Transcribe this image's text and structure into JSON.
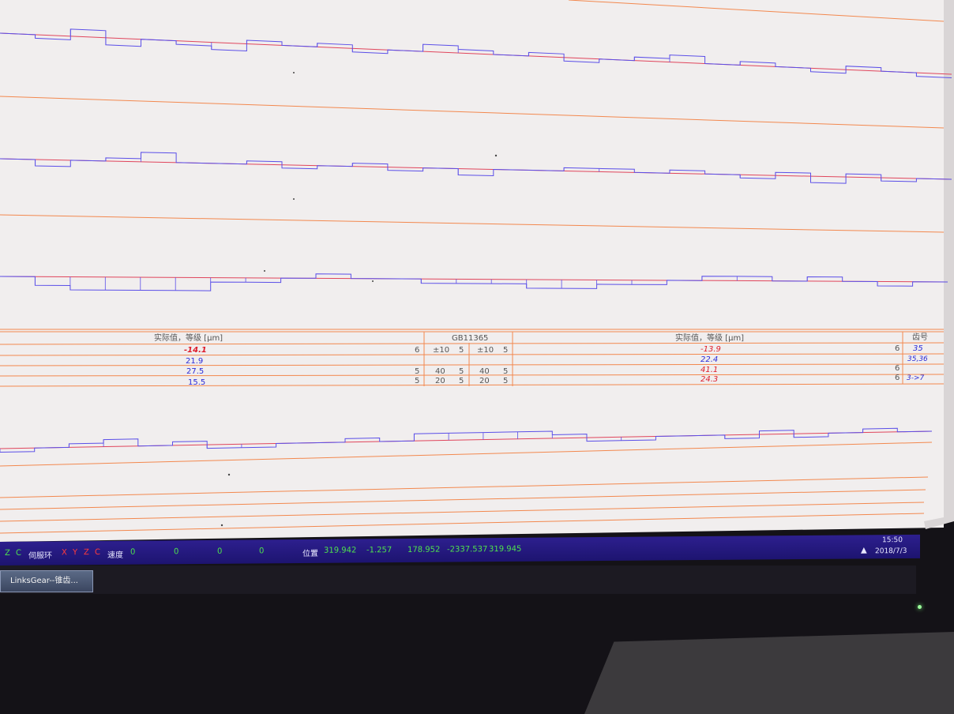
{
  "table": {
    "left_header": "实际值，等级 [µm]",
    "standard_header": "GB11365",
    "right_header": "实际值，等级 [µm]",
    "tooth_header": "齿号",
    "rows": [
      {
        "left_val": "-14.1",
        "left_grade": "6",
        "tol1": "±10",
        "g1": "5",
        "tol2": "±10",
        "g2": "5",
        "right_val": "-13.9",
        "right_grade": "6",
        "tooth": "35"
      },
      {
        "left_val": "21.9",
        "left_grade": "",
        "tol1": "",
        "g1": "",
        "tol2": "",
        "g2": "",
        "right_val": "22.4",
        "right_grade": "",
        "tooth": "35,36"
      },
      {
        "left_val": "27.5",
        "left_grade": "5",
        "tol1": "40",
        "g1": "5",
        "tol2": "40",
        "g2": "5",
        "right_val": "41.1",
        "right_grade": "6",
        "tooth": ""
      },
      {
        "left_val": "15.5",
        "left_grade": "5",
        "tol1": "20",
        "g1": "5",
        "tol2": "20",
        "g2": "5",
        "right_val": "24.3",
        "right_grade": "6",
        "tooth": "3->7"
      }
    ]
  },
  "status_bar": {
    "axes_z": "Z",
    "axes_c": "C",
    "servo_label": "伺服环",
    "servo_x": "X",
    "servo_y": "Y",
    "servo_z": "Z",
    "servo_c": "C",
    "speed_label": "速度",
    "speed_values": [
      "0",
      "0",
      "0",
      "0"
    ],
    "position_label": "位置",
    "position_values": [
      "319.942",
      "-1.257",
      "178.952",
      "-2337.537",
      "319.945"
    ]
  },
  "clock": {
    "time": "15:50",
    "date": "2018/7/3"
  },
  "taskbar": {
    "app_button": "LinksGear--锥齿..."
  },
  "colors": {
    "screen_bg": "#f1eeee",
    "grid_line": "#f2884e",
    "trace_blue": "#5b4fe8",
    "trace_red": "#e0455c",
    "status_bar": "#261a80",
    "value_blue": "#2b2bd8",
    "value_red": "#dd1b2a"
  },
  "chart_data": [
    {
      "type": "line",
      "description": "Single pitch deviation trace (band 1)",
      "series": [
        {
          "values": [
            0,
            -1,
            2,
            -2,
            0,
            -1,
            -2,
            1,
            0,
            1,
            -1,
            0,
            2,
            1,
            0,
            1,
            -1,
            0,
            1,
            2,
            0,
            1,
            0,
            -1,
            1,
            0,
            -1
          ]
        }
      ]
    },
    {
      "type": "line",
      "description": "Single pitch deviation trace (band 2)",
      "series": [
        {
          "values": [
            0,
            -2,
            0,
            1,
            3,
            0,
            0,
            1,
            -1,
            0,
            1,
            -1,
            0,
            -2,
            0,
            0,
            1,
            1,
            0,
            1,
            0,
            -1,
            1,
            -2,
            1,
            -1,
            0
          ]
        }
      ]
    },
    {
      "type": "line",
      "description": "Cumulative pitch deviation trace (band 3)",
      "series": [
        {
          "values": [
            0,
            -2,
            -3,
            -3,
            -3,
            -3,
            -1,
            -1,
            0,
            1,
            0,
            0,
            -1,
            -1,
            -1,
            -2,
            -2,
            -1,
            -1,
            0,
            1,
            1,
            0,
            1,
            0,
            -1,
            0
          ]
        }
      ]
    },
    {
      "type": "line",
      "description": "Runout trace (band 4)",
      "series": [
        {
          "values": [
            -1,
            0,
            1,
            2,
            0,
            1,
            -1,
            -1,
            0,
            0,
            1,
            0,
            2,
            2,
            2,
            2,
            1,
            -1,
            -1,
            0,
            0,
            -1,
            1,
            -1,
            0,
            1,
            0
          ]
        }
      ]
    }
  ]
}
